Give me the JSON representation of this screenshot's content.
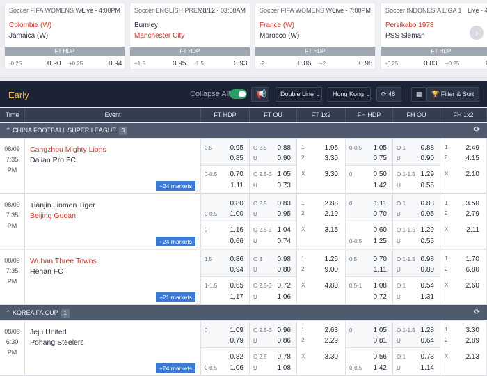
{
  "featured": [
    {
      "league": "Soccer FIFA WOMENS WO...",
      "status": "Live - 4:00PM",
      "team1": "Colombia (W)",
      "team2": "Jamaica (W)",
      "team1_red": true,
      "team2_red": false,
      "hdp_label": "FT HDP",
      "h1": "-0.25",
      "o1": "0.90",
      "h2": "+0.25",
      "o2": "0.94"
    },
    {
      "league": "Soccer ENGLISH PREM...",
      "status": "08/12 - 03:00AM",
      "team1": "Burnley",
      "team2": "Manchester City",
      "team1_red": false,
      "team2_red": true,
      "hdp_label": "FT HDP",
      "h1": "+1.5",
      "o1": "0.95",
      "h2": "-1.5",
      "o2": "0.93"
    },
    {
      "league": "Soccer FIFA WOMENS WO...",
      "status": "Live - 7:00PM",
      "team1": "France (W)",
      "team2": "Morocco (W)",
      "team1_red": true,
      "team2_red": false,
      "hdp_label": "FT HDP",
      "h1": "-2",
      "o1": "0.86",
      "h2": "+2",
      "o2": "0.98"
    },
    {
      "league": "Soccer INDONESIA LIGA 1",
      "status": "Live - 4:00",
      "team1": "Persikabo 1973",
      "team2": "PSS Sleman",
      "team1_red": true,
      "team2_red": false,
      "hdp_label": "FT HDP",
      "h1": "-0.25",
      "o1": "0.83",
      "h2": "+0.25",
      "o2": "1."
    }
  ],
  "toolbar": {
    "section": "Early",
    "collapse_label": "Collapse All",
    "view_label": "Double Line",
    "odds_label": "Hong Kong",
    "refresh_count": "48",
    "filter_label": "Filter & Sort"
  },
  "headers": [
    "Time",
    "Event",
    "FT HDP",
    "FT OU",
    "FT 1x2",
    "FH HDP",
    "FH OU",
    "FH 1x2"
  ],
  "leagues": [
    {
      "name": "CHINA FOOTBALL SUPER LEAGUE",
      "count": "3"
    },
    {
      "name": "KOREA FA CUP",
      "count": "1"
    }
  ],
  "matches": [
    {
      "date": "08/09",
      "time": "7:35",
      "ampm": "PM",
      "team1": "Cangzhou Mighty Lions",
      "team2": "Dalian Pro FC",
      "team1_red": true,
      "team2_red": false,
      "markets": "+24 markets",
      "ft_hdp": [
        [
          "0.5",
          "0.95",
          ""
        ],
        [
          "",
          "0.85",
          ""
        ],
        [
          "0-0.5",
          "0.70",
          ""
        ],
        [
          "",
          "1.11",
          ""
        ]
      ],
      "ft_ou": [
        [
          "O 2.5",
          "0.88"
        ],
        [
          "U",
          "0.90"
        ],
        [
          "O 2.5-3",
          "1.05"
        ],
        [
          "U",
          "0.73"
        ]
      ],
      "ft_1x2": [
        [
          "1",
          "1.95"
        ],
        [
          "2",
          "3.30"
        ],
        [
          "X",
          "3.30"
        ]
      ],
      "fh_hdp": [
        [
          "0-0.5",
          "1.05"
        ],
        [
          "",
          "0.75"
        ],
        [
          "0",
          "0.50"
        ],
        [
          "",
          "1.42"
        ]
      ],
      "fh_ou": [
        [
          "O 1",
          "0.88"
        ],
        [
          "U",
          "0.90"
        ],
        [
          "O 1-1.5",
          "1.29"
        ],
        [
          "U",
          "0.55"
        ]
      ],
      "fh_1x2": [
        [
          "1",
          "2.49"
        ],
        [
          "2",
          "4.15"
        ],
        [
          "X",
          "2.10"
        ]
      ]
    },
    {
      "date": "08/09",
      "time": "7:35",
      "ampm": "PM",
      "team1": "Tianjin Jinmen Tiger",
      "team2": "Beijing Guoan",
      "team1_red": false,
      "team2_red": true,
      "markets": "+24 markets",
      "ft_hdp": [
        [
          "",
          "0.80",
          ""
        ],
        [
          "0-0.5",
          "1.00",
          ""
        ],
        [
          "0",
          "1.16",
          ""
        ],
        [
          "",
          "0.66",
          ""
        ]
      ],
      "ft_ou": [
        [
          "O 2.5",
          "0.83"
        ],
        [
          "U",
          "0.95"
        ],
        [
          "O 2.5-3",
          "1.04"
        ],
        [
          "U",
          "0.74"
        ]
      ],
      "ft_1x2": [
        [
          "1",
          "2.88"
        ],
        [
          "2",
          "2.19"
        ],
        [
          "X",
          "3.15"
        ]
      ],
      "fh_hdp": [
        [
          "0",
          "1.11"
        ],
        [
          "",
          "0.70"
        ],
        [
          "",
          "0.60"
        ],
        [
          "0-0.5",
          "1.25"
        ]
      ],
      "fh_ou": [
        [
          "O 1",
          "0.83"
        ],
        [
          "U",
          "0.95"
        ],
        [
          "O 1-1.5",
          "1.29"
        ],
        [
          "U",
          "0.55"
        ]
      ],
      "fh_1x2": [
        [
          "1",
          "3.50"
        ],
        [
          "2",
          "2.79"
        ],
        [
          "X",
          "2.11"
        ]
      ]
    },
    {
      "date": "08/09",
      "time": "7:35",
      "ampm": "PM",
      "team1": "Wuhan Three Towns",
      "team2": "Henan FC",
      "team1_red": true,
      "team2_red": false,
      "markets": "+21 markets",
      "ft_hdp": [
        [
          "1.5",
          "0.86",
          ""
        ],
        [
          "",
          "0.94",
          ""
        ],
        [
          "1-1.5",
          "0.65",
          ""
        ],
        [
          "",
          "1.17",
          ""
        ]
      ],
      "ft_ou": [
        [
          "O 3",
          "0.98"
        ],
        [
          "U",
          "0.80"
        ],
        [
          "O 2.5-3",
          "0.72"
        ],
        [
          "U",
          "1.06"
        ]
      ],
      "ft_1x2": [
        [
          "1",
          "1.25"
        ],
        [
          "2",
          "9.00"
        ],
        [
          "X",
          "4.80"
        ]
      ],
      "fh_hdp": [
        [
          "0.5",
          "0.70"
        ],
        [
          "",
          "1.11"
        ],
        [
          "0.5-1",
          "1.08"
        ],
        [
          "",
          "0.72"
        ]
      ],
      "fh_ou": [
        [
          "O 1-1.5",
          "0.98"
        ],
        [
          "U",
          "0.80"
        ],
        [
          "O 1",
          "0.54"
        ],
        [
          "U",
          "1.31"
        ]
      ],
      "fh_1x2": [
        [
          "1",
          "1.70"
        ],
        [
          "2",
          "6.80"
        ],
        [
          "X",
          "2.60"
        ]
      ]
    },
    {
      "date": "08/09",
      "time": "6:30",
      "ampm": "PM",
      "team1": "Jeju United",
      "team2": "Pohang Steelers",
      "team1_red": false,
      "team2_red": false,
      "markets": "+24 markets",
      "ft_hdp": [
        [
          "0",
          "1.09",
          ""
        ],
        [
          "",
          "0.79",
          ""
        ],
        [
          "",
          "0.82",
          ""
        ],
        [
          "0-0.5",
          "1.06",
          ""
        ]
      ],
      "ft_ou": [
        [
          "O 2.5-3",
          "0.96"
        ],
        [
          "U",
          "0.86"
        ],
        [
          "O 2.5",
          "0.78"
        ],
        [
          "U",
          "1.08"
        ]
      ],
      "ft_1x2": [
        [
          "1",
          "2.63"
        ],
        [
          "2",
          "2.29"
        ],
        [
          "X",
          "3.30"
        ]
      ],
      "fh_hdp": [
        [
          "0",
          "1.05"
        ],
        [
          "",
          "0.81"
        ],
        [
          "",
          "0.56"
        ],
        [
          "0-0.5",
          "1.42"
        ]
      ],
      "fh_ou": [
        [
          "O 1-1.5",
          "1.28"
        ],
        [
          "U",
          "0.64"
        ],
        [
          "O 1",
          "0.73"
        ],
        [
          "U",
          "1.14"
        ]
      ],
      "fh_1x2": [
        [
          "1",
          "3.30"
        ],
        [
          "2",
          "2.89"
        ],
        [
          "X",
          "2.13"
        ]
      ]
    }
  ]
}
